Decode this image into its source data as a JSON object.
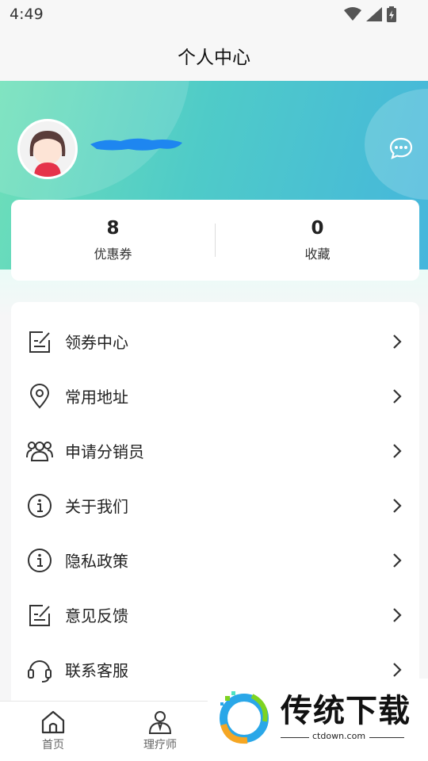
{
  "status_bar": {
    "time": "4:49"
  },
  "header": {
    "title": "个人中心"
  },
  "stats": [
    {
      "value": "8",
      "label": "优惠券"
    },
    {
      "value": "0",
      "label": "收藏"
    }
  ],
  "menu": [
    {
      "label": "领券中心",
      "icon": "edit-note-icon"
    },
    {
      "label": "常用地址",
      "icon": "location-pin-icon"
    },
    {
      "label": "申请分销员",
      "icon": "users-group-icon"
    },
    {
      "label": "关于我们",
      "icon": "info-circle-icon"
    },
    {
      "label": "隐私政策",
      "icon": "info-circle-icon"
    },
    {
      "label": "意见反馈",
      "icon": "edit-note-icon"
    },
    {
      "label": "联系客服",
      "icon": "headset-icon"
    }
  ],
  "bottom_nav": [
    {
      "label": "首页",
      "icon": "home-icon"
    },
    {
      "label": "理疗师",
      "icon": "therapist-icon"
    }
  ],
  "watermark": {
    "brand": "传统下载",
    "url": "ctdown.com"
  },
  "colors": {
    "hero_start": "#6fe0b8",
    "hero_end": "#45b6dc",
    "mask_blue": "#1e86f0"
  }
}
